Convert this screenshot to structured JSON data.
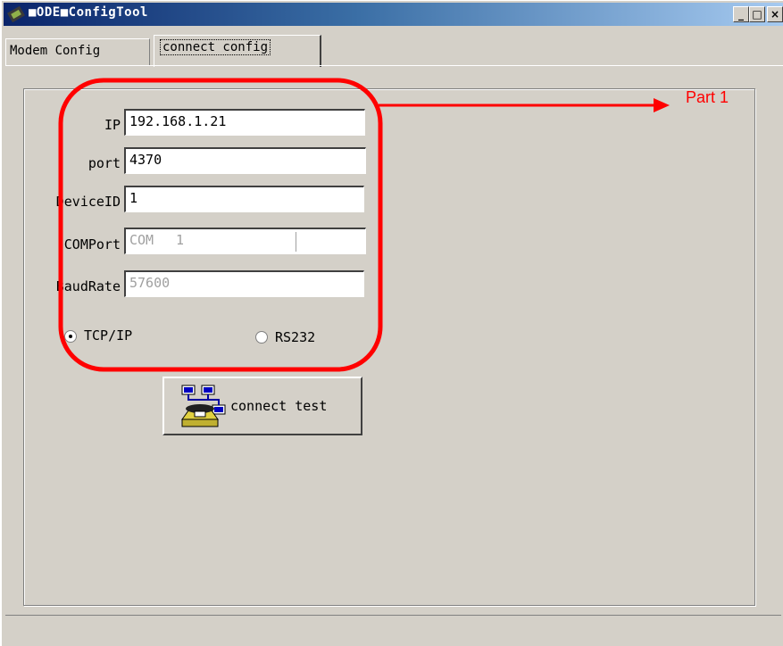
{
  "window": {
    "title": "■ODE■ConfigTool",
    "buttons": {
      "minimize": "_",
      "maximize": "□",
      "close": "×"
    }
  },
  "tabs": [
    {
      "label": "Modem Config",
      "active": false
    },
    {
      "label": "connect config",
      "active": true
    }
  ],
  "form": {
    "ip_label": "IP",
    "ip_value": "192.168.1.21",
    "port_label": "port",
    "port_value": "4370",
    "deviceid_label": "DeviceID",
    "deviceid_value": "1",
    "comport_label": "COMPort",
    "comport_prefix": "COM",
    "comport_value": "1",
    "baudrate_label": "BaudRate",
    "baudrate_value": "57600",
    "radio_tcp_label": "TCP/IP",
    "radio_rs232_label": "RS232",
    "selected_mode": "TCP/IP"
  },
  "connect_button": {
    "label": "connect test",
    "icon": "network-phone-icon"
  },
  "annotation": {
    "label": "Part 1",
    "color": "#ff0000"
  },
  "colors": {
    "titlebar_start": "#0a246a",
    "titlebar_end": "#a6caf0",
    "face": "#d4d0c8"
  }
}
